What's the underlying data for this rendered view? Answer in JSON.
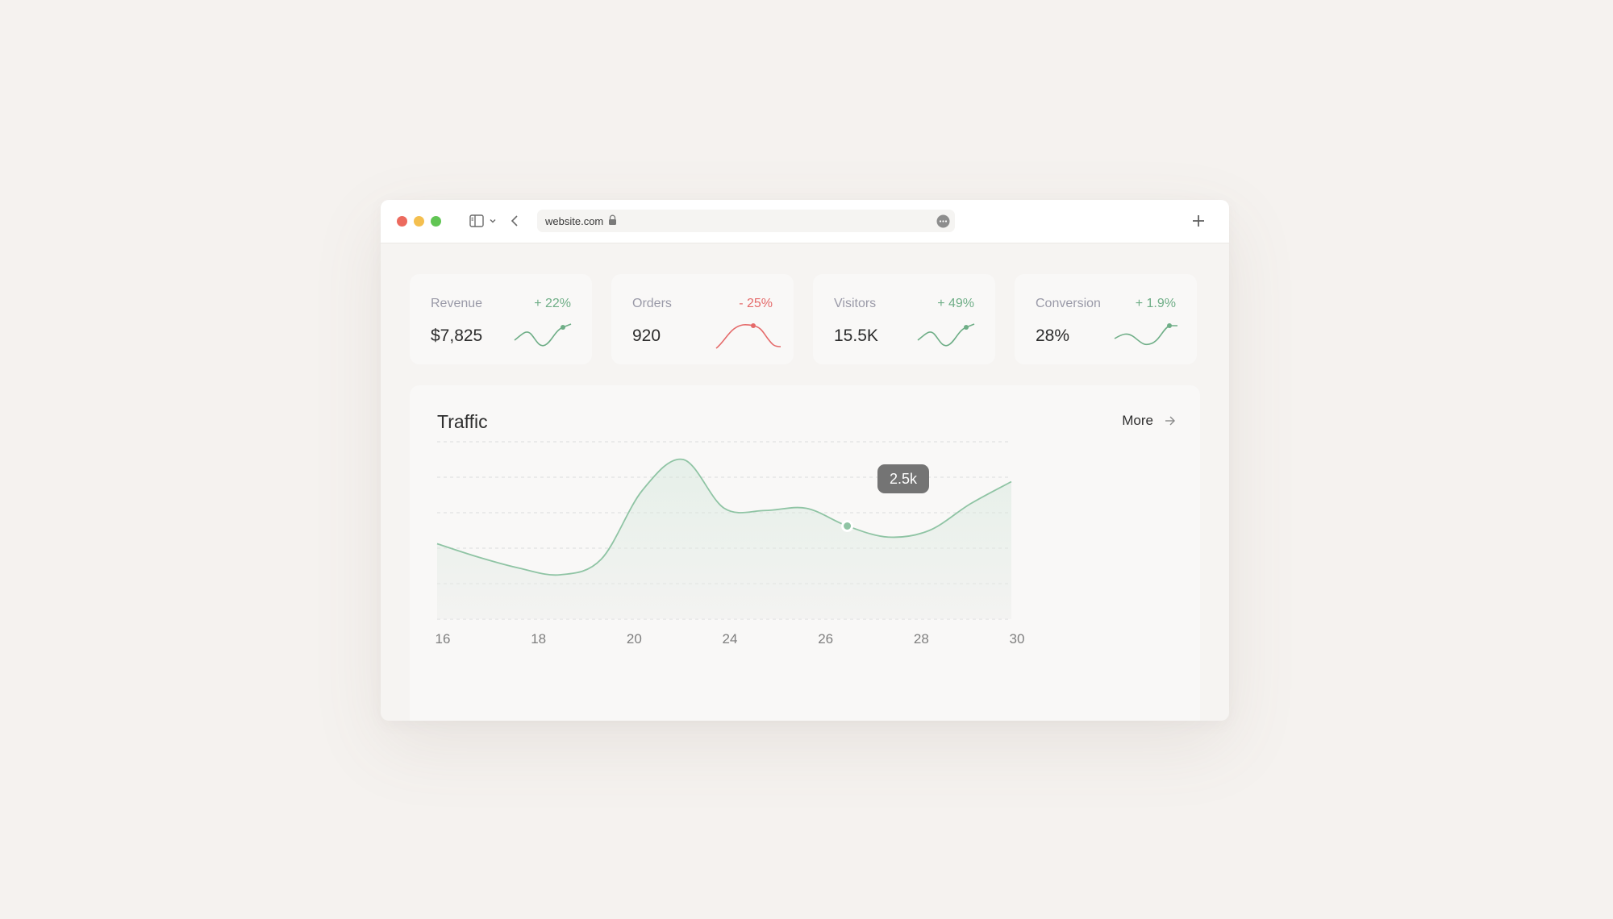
{
  "browser": {
    "url": "website.com",
    "traffic_lights": {
      "close": "#ec6a5e",
      "minimize": "#f4bf4f",
      "zoom": "#61c554"
    }
  },
  "stats": [
    {
      "label": "Revenue",
      "change": "+ 22%",
      "value": "$7,825",
      "trend": "up",
      "color": "#6fae87"
    },
    {
      "label": "Orders",
      "change": "- 25%",
      "value": "920",
      "trend": "down",
      "color": "#e56a6a"
    },
    {
      "label": "Visitors",
      "change": "+ 49%",
      "value": "15.5K",
      "trend": "up",
      "color": "#6fae87"
    },
    {
      "label": "Conversion",
      "change": "+ 1.9%",
      "value": "28%",
      "trend": "up",
      "color": "#6fae87"
    }
  ],
  "traffic": {
    "title": "Traffic",
    "more_label": "More",
    "tooltip": "2.5k"
  },
  "chart_data": {
    "type": "area",
    "x_ticks": [
      "16",
      "18",
      "20",
      "24",
      "26",
      "28",
      "30"
    ],
    "x": [
      16,
      17,
      18,
      19,
      20,
      21,
      22,
      23,
      24,
      25,
      26,
      27,
      28,
      29,
      30
    ],
    "values": [
      1.7,
      1.4,
      1.15,
      1.0,
      1.35,
      2.9,
      3.6,
      2.5,
      2.45,
      2.5,
      2.1,
      1.85,
      2.0,
      2.6,
      3.1
    ],
    "highlight": {
      "x": 26,
      "label": "2.5k"
    },
    "ylim": [
      0,
      4
    ],
    "grid": "horizontal-dashed",
    "color": "#8fc4a4"
  }
}
